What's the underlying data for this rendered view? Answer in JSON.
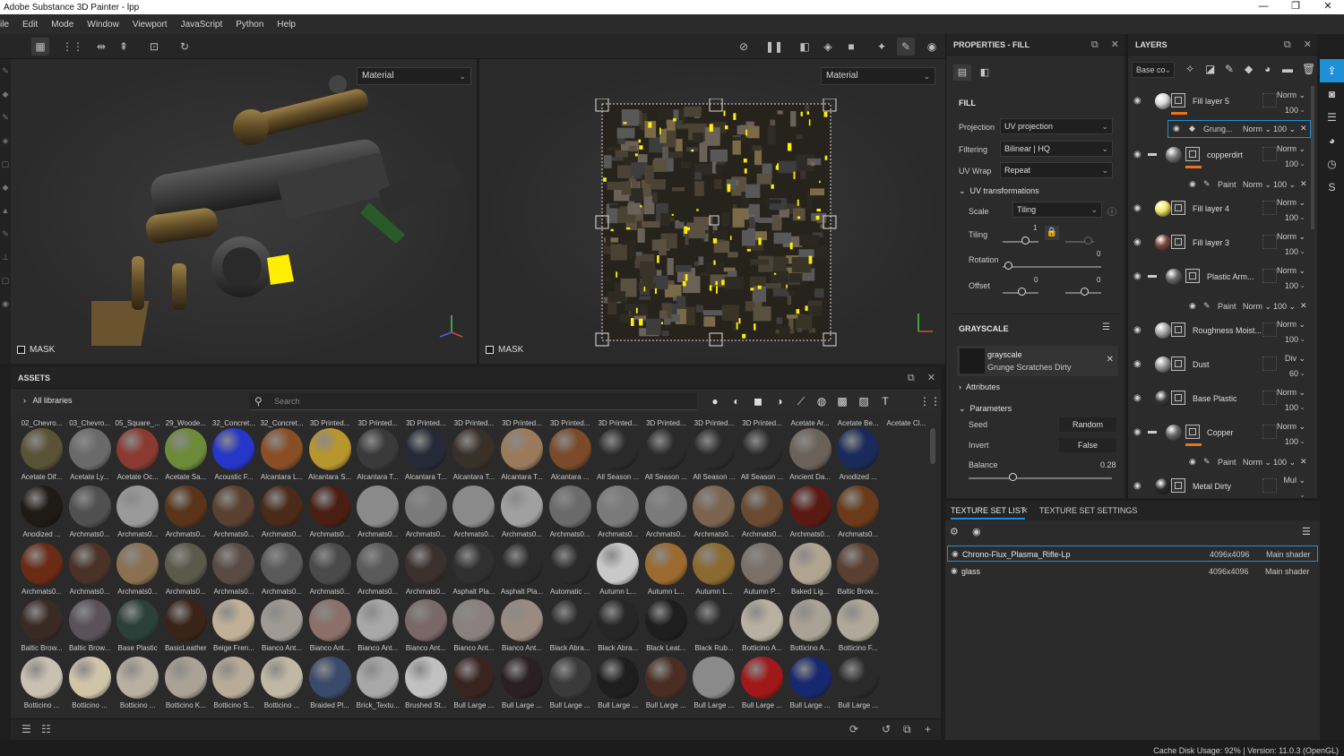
{
  "window": {
    "title": "Adobe Substance 3D Painter - lpp",
    "controls": [
      "—",
      "❐",
      "✕"
    ]
  },
  "menu": [
    "ile",
    "Edit",
    "Mode",
    "Window",
    "Viewport",
    "JavaScript",
    "Python",
    "Help"
  ],
  "viewport3d": {
    "channel_select": "Material",
    "mask_label": "MASK"
  },
  "viewport2d": {
    "channel_select": "Material",
    "mask_label": "MASK"
  },
  "properties": {
    "header": "PROPERTIES - FILL",
    "section_fill": "FILL",
    "projection_label": "Projection",
    "projection_value": "UV projection",
    "filtering_label": "Filtering",
    "filtering_value": "Bilinear | HQ",
    "uvwrap_label": "UV Wrap",
    "uvwrap_value": "Repeat",
    "uvtrans_label": "UV transformations",
    "scale_label": "Scale",
    "scale_value": "Tiling",
    "tiling_label": "Tiling",
    "tiling_value": "1",
    "rotation_label": "Rotation",
    "rotation_value": "0",
    "offset_label": "Offset",
    "offset_x": "0",
    "offset_y": "0",
    "grayscale_header": "GRAYSCALE",
    "grayscale_name": "grayscale",
    "grayscale_resource": "Grunge Scratches Dirty",
    "attributes_label": "Attributes",
    "parameters_label": "Parameters",
    "seed_label": "Seed",
    "seed_value": "Random",
    "invert_label": "Invert",
    "invert_value": "False",
    "balance_label": "Balance",
    "balance_value": "0.28"
  },
  "layers": {
    "header": "LAYERS",
    "channel_select": "Base co",
    "items": [
      {
        "name": "Fill layer 5",
        "blend": "Norm",
        "opacity": "100"
      },
      {
        "name": "Grung...",
        "blend": "Norm",
        "opacity": "100"
      },
      {
        "name": "copperdirt",
        "blend": "Norm",
        "opacity": "100"
      },
      {
        "name": "Paint",
        "blend": "Norm",
        "opacity": "100"
      },
      {
        "name": "Fill layer 4",
        "blend": "Norm",
        "opacity": "100"
      },
      {
        "name": "Fill layer 3",
        "blend": "Norm",
        "opacity": "100"
      },
      {
        "name": "Plastic Arm...",
        "blend": "Norm",
        "opacity": "100"
      },
      {
        "name": "Paint",
        "blend": "Norm",
        "opacity": "100"
      },
      {
        "name": "Roughness Moist...",
        "blend": "Norm",
        "opacity": "100"
      },
      {
        "name": "Dust",
        "blend": "Div",
        "opacity": "60"
      },
      {
        "name": "Base Plastic",
        "blend": "Norm",
        "opacity": "100"
      },
      {
        "name": "Copper",
        "blend": "Norm",
        "opacity": "100"
      },
      {
        "name": "Paint",
        "blend": "Norm",
        "opacity": "100"
      },
      {
        "name": "Metal Dirty",
        "blend": "Mul",
        "opacity": ""
      }
    ]
  },
  "texture_set": {
    "tab_list": "TEXTURE SET LIST",
    "tab_settings": "TEXTURE SET SETTINGS",
    "rows": [
      {
        "name": "Chrono-Flux_Plasma_Rifle-Lp",
        "size": "4096x4096",
        "shader": "Main shader"
      },
      {
        "name": "glass",
        "size": "4096x4096",
        "shader": "Main shader"
      }
    ]
  },
  "assets": {
    "header": "ASSETS",
    "library": "All libraries",
    "search_placeholder": "Search",
    "row1_top": [
      "02_Chevro...",
      "03_Chevro...",
      "05_Square_...",
      "29_Woode...",
      "32_Concret...",
      "32_Concret...",
      "3D Printed...",
      "3D Printed...",
      "3D Printed...",
      "3D Printed...",
      "3D Printed...",
      "3D Printed...",
      "3D Printed...",
      "3D Printed...",
      "3D Printed...",
      "3D Printed...",
      "Acetate Ar...",
      "Acetate Be...",
      "Acetate Cl..."
    ],
    "tiles": [
      {
        "label": "Acetate Dif...",
        "color": "#5a5236"
      },
      {
        "label": "Acetate Ly...",
        "color": "#6a6a6a"
      },
      {
        "label": "Acetate Oc...",
        "color": "#8a3a30"
      },
      {
        "label": "Acetate Sa...",
        "color": "#6c8a3a"
      },
      {
        "label": "Acoustic F...",
        "color": "#2636c8"
      },
      {
        "label": "Alcantara L...",
        "color": "#8a4e26"
      },
      {
        "label": "Alcantara S...",
        "color": "#b8962e"
      },
      {
        "label": "Alcantara T...",
        "color": "#3a3a3a"
      },
      {
        "label": "Alcantara T...",
        "color": "#262a38"
      },
      {
        "label": "Alcantara T...",
        "color": "#3a302a"
      },
      {
        "label": "Alcantara T...",
        "color": "#9a7a5a"
      },
      {
        "label": "Alcantara ...",
        "color": "#7a4a2a"
      },
      {
        "label": "All Season ...",
        "color": "#2a2a2a"
      },
      {
        "label": "All Season ...",
        "color": "#2a2a2a"
      },
      {
        "label": "All Season ...",
        "color": "#2a2a2a"
      },
      {
        "label": "All Season ...",
        "color": "#2a2a2a"
      },
      {
        "label": "Ancient Da...",
        "color": "#6a6258"
      },
      {
        "label": "Anodized ...",
        "color": "#1a2a5a"
      },
      {
        "label": "Anodized ...",
        "color": "#1e1a16"
      },
      {
        "label": "Archmats0...",
        "color": "#505050"
      },
      {
        "label": "Archmats0...",
        "color": "#9a9a9a"
      },
      {
        "label": "Archmats0...",
        "color": "#5a3418"
      },
      {
        "label": "Archmats0...",
        "color": "#5a4030"
      },
      {
        "label": "Archmats0...",
        "color": "#4a2a18"
      },
      {
        "label": "Archmats0...",
        "color": "#4a1e14"
      },
      {
        "label": "Archmats0...",
        "color": "#8a8a8a"
      },
      {
        "label": "Archmats0...",
        "color": "#7a7a7a"
      },
      {
        "label": "Archmats0...",
        "color": "#8a8a8a"
      },
      {
        "label": "Archmats0...",
        "color": "#a0a0a0"
      },
      {
        "label": "Archmats0...",
        "color": "#6a6a6a"
      },
      {
        "label": "Archmats0...",
        "color": "#7a7a7a"
      },
      {
        "label": "Archmats0...",
        "color": "#7a7a7a"
      },
      {
        "label": "Archmats0...",
        "color": "#7a6450"
      },
      {
        "label": "Archmats0...",
        "color": "#6a4a30"
      },
      {
        "label": "Archmats0...",
        "color": "#5a1a14"
      },
      {
        "label": "Archmats0...",
        "color": "#6a3a1a"
      },
      {
        "label": "Archmats0...",
        "color": "#6a2a14"
      },
      {
        "label": "Archmats0...",
        "color": "#4a3228"
      },
      {
        "label": "Archmats0...",
        "color": "#8a7050"
      },
      {
        "label": "Archmats0...",
        "color": "#5a5a4a"
      },
      {
        "label": "Archmats0...",
        "color": "#5a4a44"
      },
      {
        "label": "Archmats0...",
        "color": "#5a5a5a"
      },
      {
        "label": "Archmats0...",
        "color": "#4a4a4a"
      },
      {
        "label": "Archmats0...",
        "color": "#5a5a5a"
      },
      {
        "label": "Archmats0...",
        "color": "#3a302e"
      },
      {
        "label": "Asphalt Pla...",
        "color": "#303030"
      },
      {
        "label": "Asphalt Pla...",
        "color": "#2a2a2a"
      },
      {
        "label": "Automatic ...",
        "color": "#2a2a2a"
      },
      {
        "label": "Autumn L...",
        "color": "#c8c8c8"
      },
      {
        "label": "Autumn L...",
        "color": "#9a6a30"
      },
      {
        "label": "Autumn L...",
        "color": "#8a6a30"
      },
      {
        "label": "Autumn P...",
        "color": "#7a7068"
      },
      {
        "label": "Baked Lig...",
        "color": "#b0a490"
      },
      {
        "label": "Baltic Brow...",
        "color": "#5a4030"
      },
      {
        "label": "Baltic Brow...",
        "color": "#3a2a24"
      },
      {
        "label": "Baltic Brow...",
        "color": "#5a5258"
      },
      {
        "label": "Base Plastic",
        "color": "#2a4038"
      },
      {
        "label": "BasicLeather",
        "color": "#3a2418"
      },
      {
        "label": "Beige Fren...",
        "color": "#c0b098"
      },
      {
        "label": "Bianco Ant...",
        "color": "#a09a94"
      },
      {
        "label": "Bianco Ant...",
        "color": "#8a7068"
      },
      {
        "label": "Bianco Ant...",
        "color": "#a8a8a8"
      },
      {
        "label": "Bianco Ant...",
        "color": "#7a6868"
      },
      {
        "label": "Bianco Ant...",
        "color": "#8a8080"
      },
      {
        "label": "Bianco Ant...",
        "color": "#9a8a80"
      },
      {
        "label": "Black Abra...",
        "color": "#2a2a2a"
      },
      {
        "label": "Black Abra...",
        "color": "#262626"
      },
      {
        "label": "Black Leat...",
        "color": "#1e1e1e"
      },
      {
        "label": "Black Rub...",
        "color": "#2a2a2a"
      },
      {
        "label": "Botticino A...",
        "color": "#b8b0a0"
      },
      {
        "label": "Botticino A...",
        "color": "#aaa294"
      },
      {
        "label": "Botticino F...",
        "color": "#b0a898"
      },
      {
        "label": "Botticino ...",
        "color": "#c8c0b0"
      },
      {
        "label": "Botticino ...",
        "color": "#d0c4a8"
      },
      {
        "label": "Botticino ...",
        "color": "#b8b0a0"
      },
      {
        "label": "Botticino K...",
        "color": "#aaa294"
      },
      {
        "label": "Botticino S...",
        "color": "#b8ac98"
      },
      {
        "label": "Botticino ...",
        "color": "#c0b8a4"
      },
      {
        "label": "Braided Pl...",
        "color": "#3a4a6a"
      },
      {
        "label": "Brick_Textu...",
        "color": "#a8a8a8"
      },
      {
        "label": "Brushed St...",
        "color": "#c0c0c0"
      },
      {
        "label": "Bull Large ...",
        "color": "#3a2420"
      },
      {
        "label": "Bull Large ...",
        "color": "#2a2024"
      },
      {
        "label": "Bull Large ...",
        "color": "#3a3a3a"
      },
      {
        "label": "Bull Large ...",
        "color": "#1e1e1e"
      },
      {
        "label": "Bull Large ...",
        "color": "#4a2e24"
      },
      {
        "label": "Bull Large ...",
        "color": "#8a8a8a"
      },
      {
        "label": "Bull Large ...",
        "color": "#a01818"
      },
      {
        "label": "Bull Large ...",
        "color": "#182870"
      },
      {
        "label": "Bull Large ...",
        "color": "#2a2a2a"
      }
    ]
  },
  "status": {
    "text": "Cache Disk Usage:   92% | Version: 11.0.3 (OpenGL)"
  },
  "colors": {
    "accent": "#1e90d6",
    "orange": "#e8741a",
    "mask_yellow": "#ffee00"
  }
}
